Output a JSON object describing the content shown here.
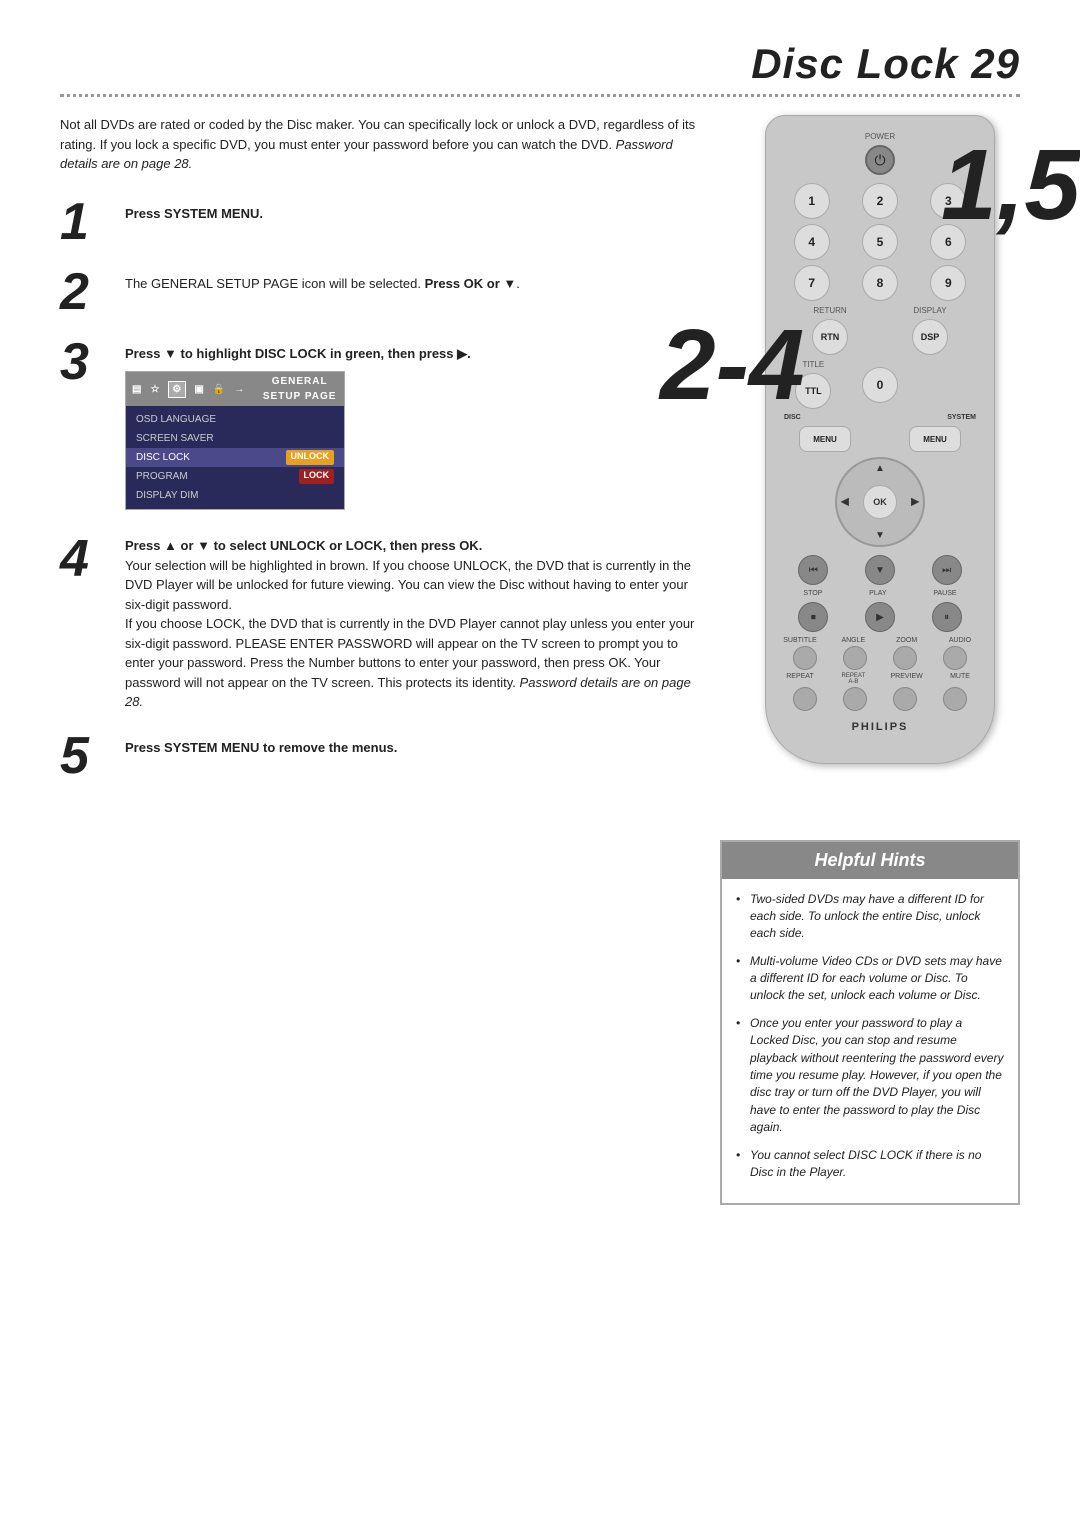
{
  "page": {
    "title": "Disc Lock 29",
    "dotted_separator": true,
    "intro_text": "Not all DVDs are rated or coded by the Disc maker. You can specifically lock or unlock a DVD, regardless of its rating. If you lock a specific DVD, you must enter your password before you can watch the DVD.",
    "intro_italic": "Password details are on page 28.",
    "steps": [
      {
        "number": "1",
        "content_bold": "Press SYSTEM MENU."
      },
      {
        "number": "2",
        "content": "The GENERAL SETUP PAGE icon will be selected.",
        "content_bold_inline": "Press OK or",
        "content_after": "▼."
      },
      {
        "number": "3",
        "content_bold": "Press ▼ to highlight DISC LOCK in green, then press ▶.",
        "has_screenshot": true
      },
      {
        "number": "4",
        "content_bold": "Press ▲ or ▼ to select UNLOCK or LOCK, then press OK.",
        "content_body": "Your selection will be highlighted in brown. If you choose UNLOCK, the DVD that is currently in the DVD Player will be unlocked for future viewing. You can view the Disc without having to enter your six-digit password.\nIf you choose LOCK, the DVD that is currently in the DVD Player cannot play unless you enter your six-digit password. PLEASE ENTER PASSWORD will appear on the TV screen to prompt you to enter your password. Press the Number buttons to enter your password, then press OK. Your password will not appear on the TV screen. This protects its identity.",
        "content_italic_end": "Password details are on page 28."
      },
      {
        "number": "5",
        "content_bold": "Press SYSTEM MENU to remove the menus."
      }
    ],
    "menu_screenshot": {
      "title": "GENERAL SETUP PAGE",
      "icons": [
        "▤",
        "☆",
        "⚙",
        "▣",
        "🔒",
        "→"
      ],
      "rows": [
        {
          "label": "OSD LANGUAGE",
          "badge": null,
          "highlight": false
        },
        {
          "label": "SCREEN SAVER",
          "badge": null,
          "highlight": false
        },
        {
          "label": "DISC LOCK",
          "badge": "UNLOCK",
          "badge_type": "orange",
          "highlight": true
        },
        {
          "label": "PROGRAM",
          "badge": "LOCK",
          "badge_type": "red",
          "highlight": false
        },
        {
          "label": "DISPLAY DIM",
          "badge": null,
          "highlight": false
        }
      ]
    },
    "overlay_numbers": {
      "top_right": "1,5",
      "mid_left": "2-4"
    },
    "remote": {
      "power_label": "POWER",
      "buttons_row1": [
        "1",
        "2",
        "3"
      ],
      "buttons_row2": [
        "4",
        "5",
        "6"
      ],
      "buttons_row3": [
        "7",
        "8",
        "9"
      ],
      "return_label": "RETURN",
      "display_label": "DISPLAY",
      "title_label": "TITLE",
      "zero_label": "0",
      "disc_label": "DISC",
      "system_label": "SYSTEM",
      "menu_labels": [
        "MENU",
        "MENU"
      ],
      "nav_center": "OK",
      "transport_labels": [
        "STOP",
        "PLAY",
        "PAUSE"
      ],
      "small_labels": [
        "SUBTITLE",
        "ANGLE",
        "ZOOM",
        "AUDIO"
      ],
      "repeat_labels": [
        "REPEAT",
        "REPEAT A-B",
        "PREVIEW",
        "MUTE"
      ],
      "brand": "PHILIPS"
    },
    "helpful_hints": {
      "title": "Helpful Hints",
      "items": [
        "Two-sided DVDs may have a different ID for each side. To unlock the entire Disc, unlock each side.",
        "Multi-volume Video CDs or DVD sets may have a different ID for each volume or Disc. To unlock the set, unlock each volume or Disc.",
        "Once you enter your password to play a Locked Disc, you can stop and resume playback without reentering the password every time you resume play. However, if you open the disc tray or turn off the DVD Player, you will have to enter the password to play the Disc again.",
        "You cannot select DISC LOCK if there is no Disc in the Player."
      ]
    }
  }
}
